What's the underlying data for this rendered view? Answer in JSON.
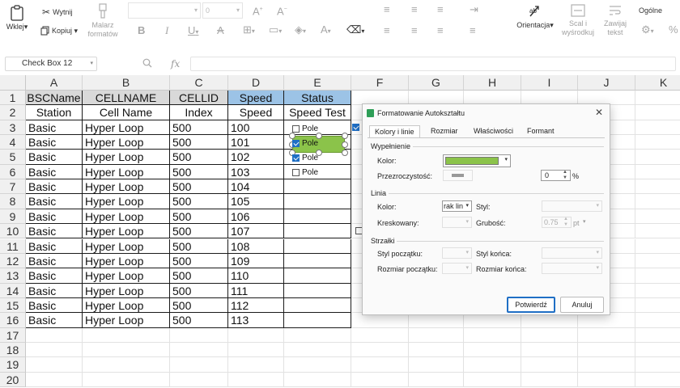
{
  "ribbon": {
    "paste_label": "Wklej",
    "cut_label": "Wytnij",
    "copy_label": "Kopiuj",
    "format_painter_label": "Malarz formatów",
    "font_size_value": "0",
    "orientation_label": "Orientacja",
    "merge_label": "Scal i wyśrodkuj",
    "wrap_label": "Zawijaj tekst",
    "number_format_label": "Ogólne"
  },
  "formula_bar": {
    "name_box": "Check Box 12",
    "fx_label": "fx"
  },
  "grid": {
    "columns": [
      "A",
      "B",
      "C",
      "D",
      "E",
      "F",
      "G",
      "H",
      "I",
      "J",
      "K"
    ],
    "rows": [
      "1",
      "2",
      "3",
      "4",
      "5",
      "6",
      "7",
      "8",
      "9",
      "10",
      "11",
      "12",
      "13",
      "14",
      "15",
      "16",
      "17",
      "18",
      "19",
      "20"
    ],
    "header_row1": [
      "BSCName",
      "CELLNAME",
      "CELLID",
      "Speed",
      "Status"
    ],
    "header_row2": [
      "Station",
      "Cell Name",
      "Index",
      "Speed",
      "Speed Test"
    ],
    "data": [
      [
        "Basic",
        "Hyper Loop",
        "500",
        "100"
      ],
      [
        "Basic",
        "Hyper Loop",
        "500",
        "101"
      ],
      [
        "Basic",
        "Hyper Loop",
        "500",
        "102"
      ],
      [
        "Basic",
        "Hyper Loop",
        "500",
        "103"
      ],
      [
        "Basic",
        "Hyper Loop",
        "500",
        "104"
      ],
      [
        "Basic",
        "Hyper Loop",
        "500",
        "105"
      ],
      [
        "Basic",
        "Hyper Loop",
        "500",
        "106"
      ],
      [
        "Basic",
        "Hyper Loop",
        "500",
        "107"
      ],
      [
        "Basic",
        "Hyper Loop",
        "500",
        "108"
      ],
      [
        "Basic",
        "Hyper Loop",
        "500",
        "109"
      ],
      [
        "Basic",
        "Hyper Loop",
        "500",
        "110"
      ],
      [
        "Basic",
        "Hyper Loop",
        "500",
        "111"
      ],
      [
        "Basic",
        "Hyper Loop",
        "500",
        "112"
      ],
      [
        "Basic",
        "Hyper Loop",
        "500",
        "113"
      ]
    ],
    "checkboxes": [
      {
        "label": "Pole",
        "checked": false
      },
      {
        "label": "Pole",
        "checked": true
      },
      {
        "label": "Pole",
        "checked": true
      },
      {
        "label": "Pole",
        "checked": false
      }
    ],
    "colors": {
      "header_grey": "#d9d9d9",
      "header_blue": "#9cc3e6",
      "shape_fill": "#8bc34a"
    }
  },
  "dialog": {
    "title": "Formatowanie Autokształtu",
    "tabs": [
      "Kolory i linie",
      "Rozmiar",
      "Właściwości",
      "Formant"
    ],
    "fill_section": "Wypełnienie",
    "color_label": "Kolor:",
    "fill_color": "#8bc34a",
    "transparency_label": "Przezroczystość:",
    "transparency_value": "0",
    "percent": "%",
    "line_section": "Linia",
    "line_color_label": "Kolor:",
    "line_color_value": "rak lin",
    "style_label": "Styl:",
    "dashed_label": "Kreskowany:",
    "weight_label": "Grubość:",
    "weight_value": "0.75",
    "weight_unit": "pt",
    "arrows_section": "Strzałki",
    "begin_style_label": "Styl początku:",
    "end_style_label": "Styl końca:",
    "begin_size_label": "Rozmiar początku:",
    "end_size_label": "Rozmiar końca:",
    "ok_label": "Potwierdź",
    "cancel_label": "Anuluj"
  }
}
